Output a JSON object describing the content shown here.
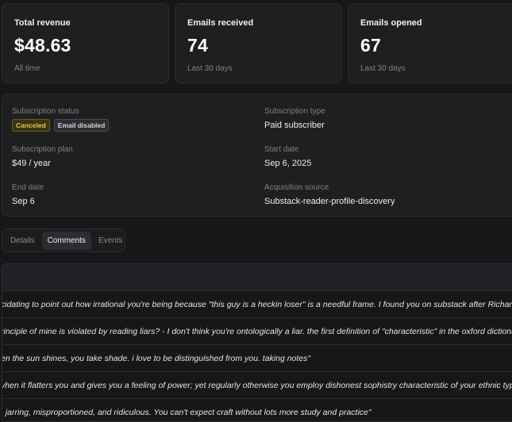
{
  "stats": [
    {
      "label": "Total revenue",
      "value": "$48.63",
      "sub": "All time"
    },
    {
      "label": "Emails received",
      "value": "74",
      "sub": "Last 30 days"
    },
    {
      "label": "Emails opened",
      "value": "67",
      "sub": "Last 30 days"
    }
  ],
  "subscription": {
    "status_label": "Subscription status",
    "badge_canceled": "Canceled",
    "badge_email": "Email disabled",
    "type_label": "Subscription type",
    "type_value": "Paid subscriber",
    "plan_label": "Subscription plan",
    "plan_value": "$49 / year",
    "start_label": "Start date",
    "start_value": "Sep 6, 2025",
    "end_label": "End date",
    "end_value": "Sep 6",
    "source_label": "Acquisition source",
    "source_value": "Substack-reader-profile-discovery"
  },
  "tabs": [
    {
      "label": "Details"
    },
    {
      "label": "Comments"
    },
    {
      "label": "Events"
    }
  ],
  "comments": [
    "cidating to point out how irrational you're being because \"this guy is a heckin loser\" is a needful frame. I found you on substack after Richard S",
    "rinciple of mine is violated by reading liars? - I don't think you're ontologically a liar. the first definition of \"characteristic\" in the oxford dictiona",
    "en the sun shines, you take shade. i love to be distinguished from you. taking notes\"",
    "vhen it flatters you and gives you a feeling of power; yet regularly otherwise you employ dishonest sophistry characteristic of your ethnic type. s",
    ", jarring, misproportioned, and ridiculous. You can't expect craft without lots more study and practice\""
  ]
}
